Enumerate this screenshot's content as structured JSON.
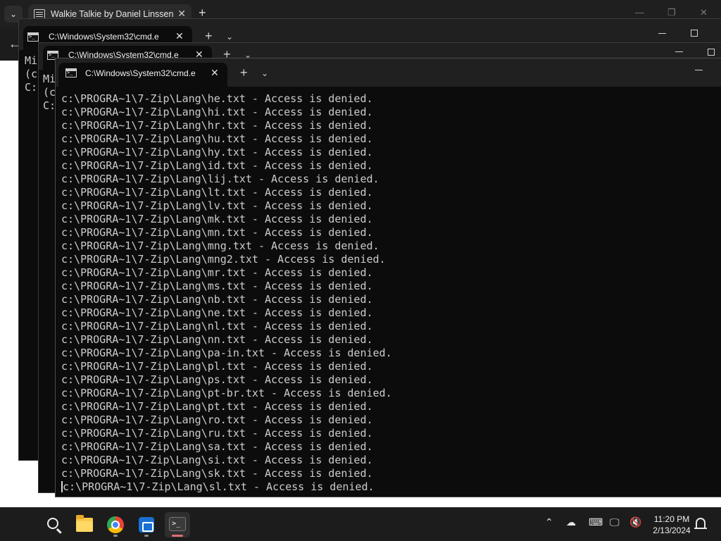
{
  "browser": {
    "tab_title": "Walkie Talkie by Daniel Linssen",
    "tab_close": "✕",
    "new_tab": "+",
    "tab_list": "⌄",
    "back": "←",
    "controls": {
      "min": "—",
      "max": "❐",
      "close": "✕"
    }
  },
  "terminal_back": {
    "title": "C:\\Windows\\System32\\cmd.e",
    "close": "✕",
    "new_tab": "+",
    "dropdown": "⌄",
    "lines": [
      "Mi",
      "(c",
      "",
      "C:"
    ]
  },
  "terminal_mid": {
    "title": "C:\\Windows\\System32\\cmd.e",
    "close": "✕",
    "new_tab": "+",
    "dropdown": "⌄",
    "lines": [
      "Mi",
      "(c",
      "",
      "C:"
    ]
  },
  "terminal_front": {
    "title": "C:\\Windows\\System32\\cmd.e",
    "close": "✕",
    "new_tab": "+",
    "dropdown": "⌄",
    "lines": [
      "c:\\PROGRA~1\\7-Zip\\Lang\\he.txt - Access is denied.",
      "c:\\PROGRA~1\\7-Zip\\Lang\\hi.txt - Access is denied.",
      "c:\\PROGRA~1\\7-Zip\\Lang\\hr.txt - Access is denied.",
      "c:\\PROGRA~1\\7-Zip\\Lang\\hu.txt - Access is denied.",
      "c:\\PROGRA~1\\7-Zip\\Lang\\hy.txt - Access is denied.",
      "c:\\PROGRA~1\\7-Zip\\Lang\\id.txt - Access is denied.",
      "c:\\PROGRA~1\\7-Zip\\Lang\\lij.txt - Access is denied.",
      "c:\\PROGRA~1\\7-Zip\\Lang\\lt.txt - Access is denied.",
      "c:\\PROGRA~1\\7-Zip\\Lang\\lv.txt - Access is denied.",
      "c:\\PROGRA~1\\7-Zip\\Lang\\mk.txt - Access is denied.",
      "c:\\PROGRA~1\\7-Zip\\Lang\\mn.txt - Access is denied.",
      "c:\\PROGRA~1\\7-Zip\\Lang\\mng.txt - Access is denied.",
      "c:\\PROGRA~1\\7-Zip\\Lang\\mng2.txt - Access is denied.",
      "c:\\PROGRA~1\\7-Zip\\Lang\\mr.txt - Access is denied.",
      "c:\\PROGRA~1\\7-Zip\\Lang\\ms.txt - Access is denied.",
      "c:\\PROGRA~1\\7-Zip\\Lang\\nb.txt - Access is denied.",
      "c:\\PROGRA~1\\7-Zip\\Lang\\ne.txt - Access is denied.",
      "c:\\PROGRA~1\\7-Zip\\Lang\\nl.txt - Access is denied.",
      "c:\\PROGRA~1\\7-Zip\\Lang\\nn.txt - Access is denied.",
      "c:\\PROGRA~1\\7-Zip\\Lang\\pa-in.txt - Access is denied.",
      "c:\\PROGRA~1\\7-Zip\\Lang\\pl.txt - Access is denied.",
      "c:\\PROGRA~1\\7-Zip\\Lang\\ps.txt - Access is denied.",
      "c:\\PROGRA~1\\7-Zip\\Lang\\pt-br.txt - Access is denied.",
      "c:\\PROGRA~1\\7-Zip\\Lang\\pt.txt - Access is denied.",
      "c:\\PROGRA~1\\7-Zip\\Lang\\ro.txt - Access is denied.",
      "c:\\PROGRA~1\\7-Zip\\Lang\\ru.txt - Access is denied.",
      "c:\\PROGRA~1\\7-Zip\\Lang\\sa.txt - Access is denied.",
      "c:\\PROGRA~1\\7-Zip\\Lang\\si.txt - Access is denied.",
      "c:\\PROGRA~1\\7-Zip\\Lang\\sk.txt - Access is denied.",
      "c:\\PROGRA~1\\7-Zip\\Lang\\sl.txt - Access is denied."
    ]
  },
  "taskbar": {
    "apps": [
      "search-icon",
      "file-explorer-icon",
      "chrome-icon",
      "store-icon",
      "terminal-icon"
    ],
    "tray": {
      "chevron": "⌃",
      "onedrive": "☁",
      "keyboard": "⌨",
      "network": "🖵",
      "volume": "🔇"
    },
    "clock": {
      "time": "11:20 PM",
      "date": "2/13/2024"
    }
  },
  "colors": {
    "terminal_bg": "#0c0c0c",
    "terminal_fg": "#cccccc",
    "titlebar": "#202020",
    "taskbar": "#1c1c1c"
  }
}
